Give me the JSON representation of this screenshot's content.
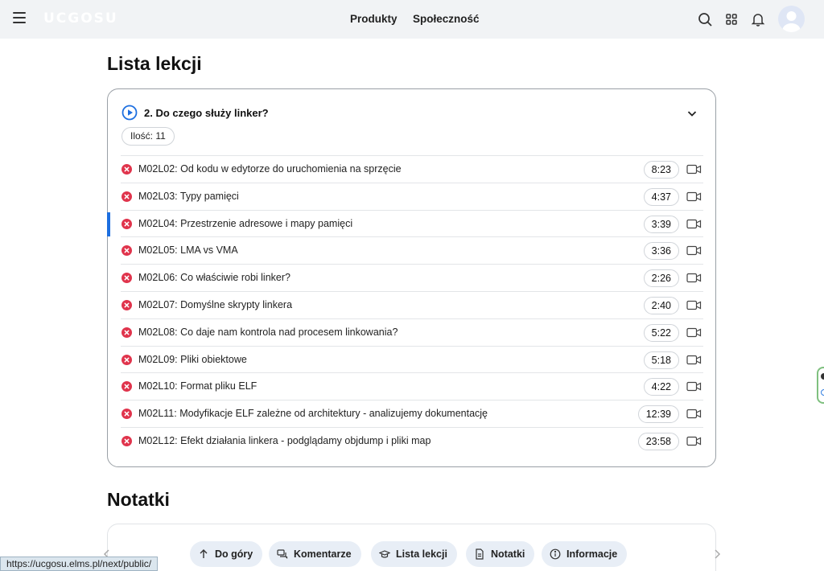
{
  "header": {
    "logo_text": "UCGOSU",
    "nav": [
      "Produkty",
      "Społeczność"
    ],
    "icons": [
      "search-icon",
      "apps-grid-icon",
      "bell-icon",
      "avatar"
    ]
  },
  "lessons_section": {
    "title": "Lista lekcji",
    "module_title": "2. Do czego służy linker?",
    "count_label": "Ilość: 11",
    "items": [
      {
        "title": "M02L02: Od kodu w edytorze do uruchomienia na sprzęcie",
        "duration": "8:23",
        "active": false
      },
      {
        "title": "M02L03: Typy pamięci",
        "duration": "4:37",
        "active": false
      },
      {
        "title": "M02L04: Przestrzenie adresowe i mapy pamięci",
        "duration": "3:39",
        "active": true
      },
      {
        "title": "M02L05: LMA vs VMA",
        "duration": "3:36",
        "active": false
      },
      {
        "title": "M02L06: Co właściwie robi linker?",
        "duration": "2:26",
        "active": false
      },
      {
        "title": "M02L07: Domyślne skrypty linkera",
        "duration": "2:40",
        "active": false
      },
      {
        "title": "M02L08: Co daje nam kontrola nad procesem linkowania?",
        "duration": "5:22",
        "active": false
      },
      {
        "title": "M02L09: Pliki obiektowe",
        "duration": "5:18",
        "active": false
      },
      {
        "title": "M02L10: Format pliku ELF",
        "duration": "4:22",
        "active": false
      },
      {
        "title": "M02L11: Modyfikacje ELF zależne od architektury - analizujemy dokumentację",
        "duration": "12:39",
        "active": false
      },
      {
        "title": "M02L12: Efekt działania linkera - podglądamy objdump i pliki map",
        "duration": "23:58",
        "active": false
      }
    ]
  },
  "notes_section": {
    "title": "Notatki"
  },
  "bottom_bar": {
    "buttons": [
      {
        "label": "Do góry",
        "icon": "arrow-up-icon"
      },
      {
        "label": "Komentarze",
        "icon": "comments-icon"
      },
      {
        "label": "Lista lekcji",
        "icon": "graduation-cap-icon"
      },
      {
        "label": "Notatki",
        "icon": "document-icon"
      },
      {
        "label": "Informacje",
        "icon": "info-icon"
      }
    ]
  },
  "status_url": "https://ucgosu.elms.pl/next/public/",
  "colors": {
    "accent": "#1d6fe0",
    "status_incomplete": "#e0344c",
    "topbar_bg": "#f1f3f5",
    "pill_bg": "#e8eef6"
  }
}
